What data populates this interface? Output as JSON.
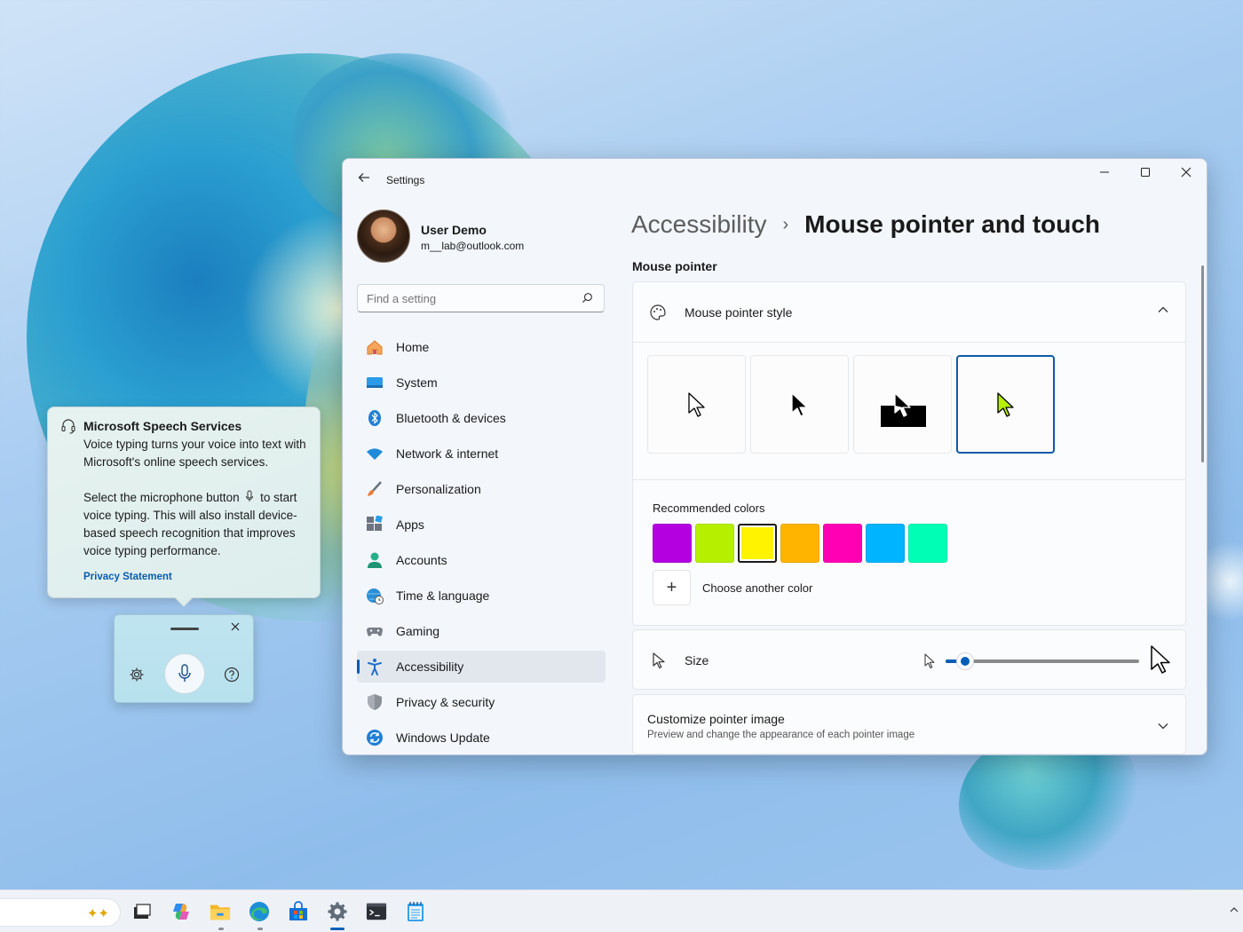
{
  "window": {
    "app_title": "Settings",
    "back_icon": "back-arrow-icon",
    "controls": [
      "minimize-icon",
      "maximize-icon",
      "close-icon"
    ]
  },
  "profile": {
    "name": "User Demo",
    "email": "m__lab@outlook.com"
  },
  "search": {
    "placeholder": "Find a setting",
    "value": ""
  },
  "nav": {
    "items": [
      {
        "label": "Home",
        "icon": "home-icon"
      },
      {
        "label": "System",
        "icon": "system-icon"
      },
      {
        "label": "Bluetooth & devices",
        "icon": "bluetooth-icon"
      },
      {
        "label": "Network & internet",
        "icon": "wifi-icon"
      },
      {
        "label": "Personalization",
        "icon": "brush-icon"
      },
      {
        "label": "Apps",
        "icon": "apps-icon"
      },
      {
        "label": "Accounts",
        "icon": "person-icon"
      },
      {
        "label": "Time & language",
        "icon": "globe-clock-icon"
      },
      {
        "label": "Gaming",
        "icon": "gamepad-icon"
      },
      {
        "label": "Accessibility",
        "icon": "accessibility-icon"
      },
      {
        "label": "Privacy & security",
        "icon": "shield-icon"
      },
      {
        "label": "Windows Update",
        "icon": "update-icon"
      }
    ],
    "active_index": 9
  },
  "content": {
    "breadcrumb_parent": "Accessibility",
    "breadcrumb_separator": "›",
    "page_title": "Mouse pointer and touch",
    "section_label": "Mouse pointer",
    "style_card": {
      "title": "Mouse pointer style",
      "options": [
        "white",
        "black",
        "inverted",
        "custom"
      ],
      "selected_option": "custom",
      "recommended_label": "Recommended colors",
      "colors": [
        "#b400e0",
        "#b6ef00",
        "#fff300",
        "#ffb400",
        "#ff00b4",
        "#00b4ff",
        "#00ffb4"
      ],
      "selected_color_index": 2,
      "choose_color_label": "Choose another color",
      "choose_color_symbol": "+"
    },
    "size_card": {
      "label": "Size",
      "value_fraction": 0.1
    },
    "custom_card": {
      "title": "Customize pointer image",
      "subtitle": "Preview and change the appearance of each pointer image"
    }
  },
  "speech": {
    "title": "Microsoft Speech Services",
    "body_1": "Voice typing turns your voice into text with Microsoft's online speech services.",
    "body_2_a": "Select the microphone button",
    "body_2_b": "to start voice typing. This will also install device-based speech recognition that improves voice typing performance.",
    "link": "Privacy Statement"
  },
  "voice_bar": {
    "icons": [
      "settings-icon",
      "microphone-icon",
      "help-icon",
      "close-icon"
    ]
  },
  "colors": {
    "accent": "#005fb8",
    "selected_pointer_color": "#b6ef00",
    "link": "#0b5cad"
  },
  "taskbar": {
    "icons": [
      "copilot-sparkle-icon",
      "task-view-icon",
      "copilot-icon",
      "file-explorer-icon",
      "edge-icon",
      "store-icon",
      "settings-icon",
      "terminal-icon",
      "notepad-icon"
    ]
  }
}
